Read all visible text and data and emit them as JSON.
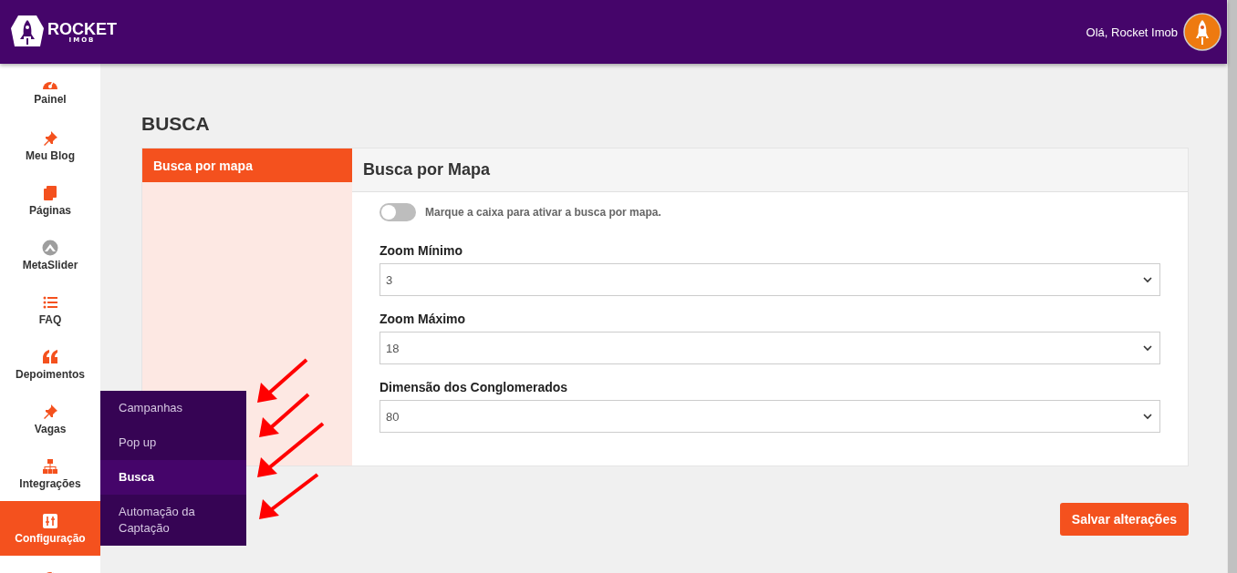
{
  "header": {
    "logo_text": "ROCKET",
    "logo_subtext": "IMOB",
    "greeting": "Olá, Rocket Imob"
  },
  "sidebar": {
    "items": [
      {
        "label": "Painel",
        "selected": false
      },
      {
        "label": "Meu Blog",
        "selected": false
      },
      {
        "label": "Páginas",
        "selected": false
      },
      {
        "label": "MetaSlider",
        "selected": false
      },
      {
        "label": "FAQ",
        "selected": false
      },
      {
        "label": "Depoimentos",
        "selected": false
      },
      {
        "label": "Vagas",
        "selected": false
      },
      {
        "label": "Integrações",
        "selected": false
      },
      {
        "label": "Configuração",
        "selected": true
      }
    ]
  },
  "flyout_menu": {
    "items": [
      {
        "label": "Campanhas",
        "selected": false
      },
      {
        "label": "Pop up",
        "selected": false
      },
      {
        "label": "Busca",
        "selected": true
      },
      {
        "label": "Automação da Captação",
        "selected": false
      }
    ]
  },
  "page": {
    "title": "BUSCA",
    "tabs": [
      {
        "label": "Busca por mapa",
        "selected": true
      }
    ],
    "section_title": "Busca por Mapa",
    "toggle": {
      "label": "Marque a caixa para ativar a busca por mapa.",
      "on": false
    },
    "fields": [
      {
        "label": "Zoom Mínimo",
        "value": "3"
      },
      {
        "label": "Zoom Máximo",
        "value": "18"
      },
      {
        "label": "Dimensão dos Conglomerados",
        "value": "80"
      }
    ],
    "save_button": "Salvar alterações"
  }
}
